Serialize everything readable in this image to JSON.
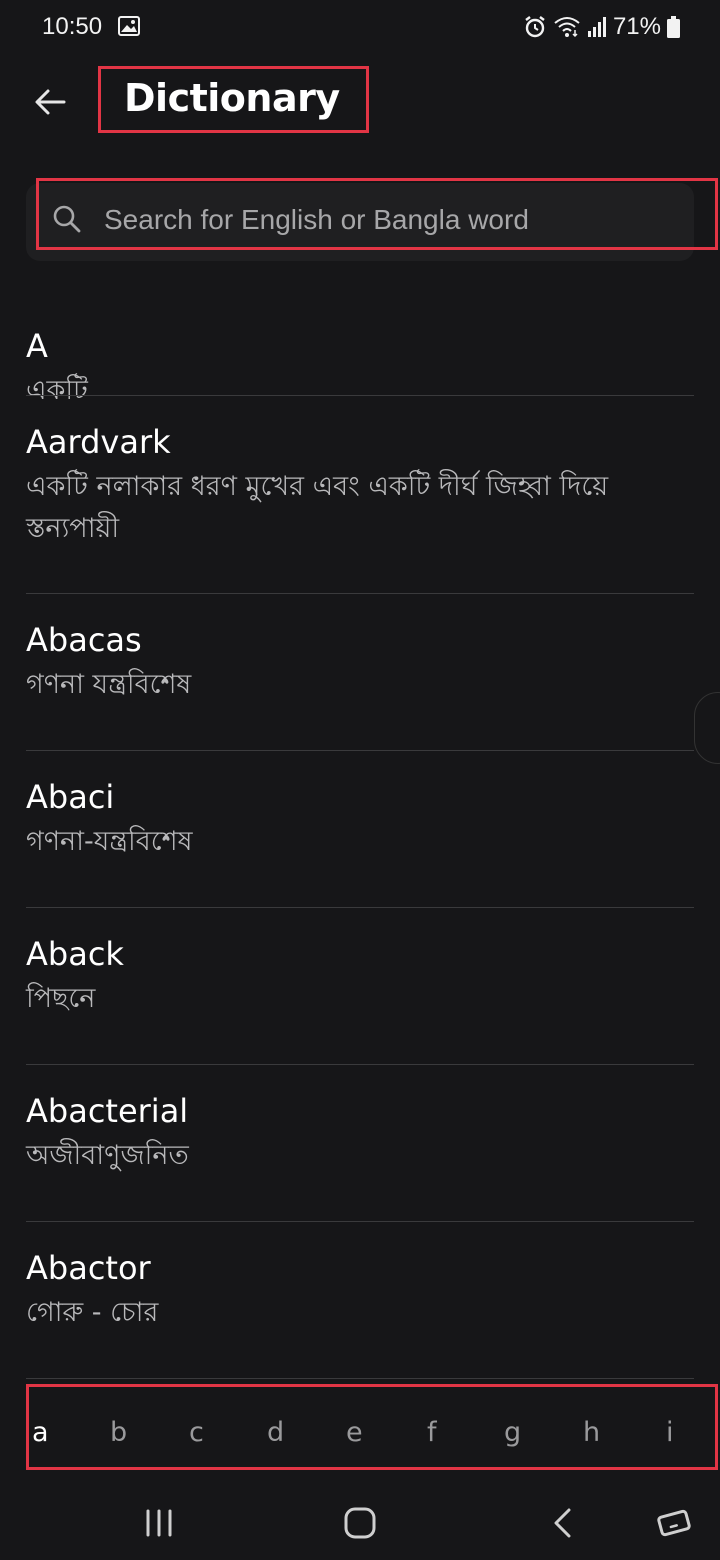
{
  "status_bar": {
    "time": "10:50",
    "battery": "71%",
    "icons": [
      "image-icon",
      "alarm-icon",
      "wifi-icon",
      "signal-icon",
      "battery-icon"
    ]
  },
  "header": {
    "title": "Dictionary",
    "back_icon": "arrow-left-icon"
  },
  "search": {
    "placeholder": "Search for English or Bangla word",
    "value": "",
    "icon": "search-icon"
  },
  "words": [
    {
      "word": "A",
      "meaning": "একটি"
    },
    {
      "word": "Aardvark",
      "meaning": "একটি নলাকার ধরণ মুখের এবং একটি দীর্ঘ জিহ্বা দিয়ে স্তন্যপায়ী"
    },
    {
      "word": "Abacas",
      "meaning": "গণনা যন্ত্রবিশেষ"
    },
    {
      "word": "Abaci",
      "meaning": "গণনা-যন্ত্রবিশেষ"
    },
    {
      "word": "Aback",
      "meaning": "পিছনে"
    },
    {
      "word": "Abacterial",
      "meaning": "অজীবাণুজনিত"
    },
    {
      "word": "Abactor",
      "meaning": "গোরু - চোর"
    }
  ],
  "alphabet": {
    "letters": [
      "a",
      "b",
      "c",
      "d",
      "e",
      "f",
      "g",
      "h",
      "i"
    ],
    "selected": "a"
  },
  "colors": {
    "background": "#161618",
    "highlight": "#e23545",
    "divider": "#3a3a3c"
  }
}
